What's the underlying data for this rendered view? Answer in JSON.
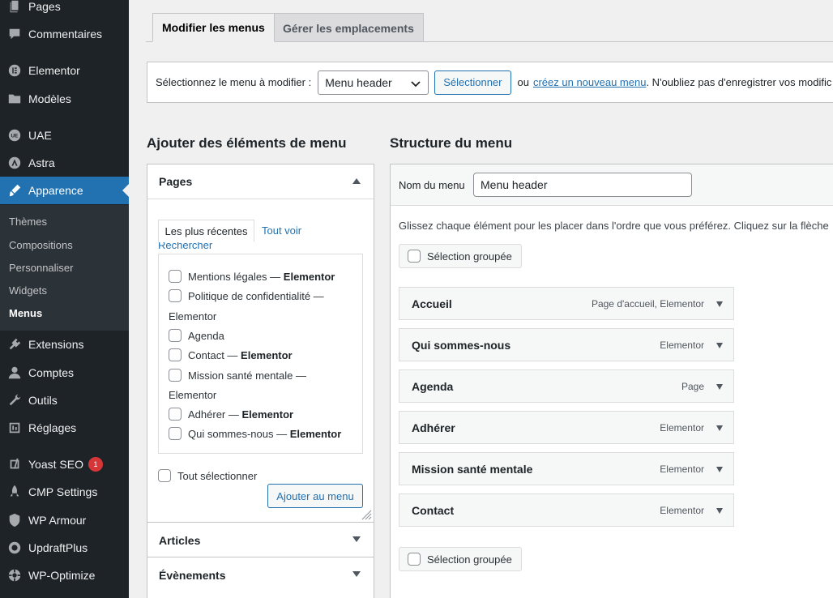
{
  "sidebar": {
    "items": [
      {
        "label": "Pages",
        "icon": "pages-icon"
      },
      {
        "label": "Commentaires",
        "icon": "comments-icon"
      },
      {
        "label": "Elementor",
        "icon": "elementor-icon"
      },
      {
        "label": "Modèles",
        "icon": "folder-icon"
      },
      {
        "label": "UAE",
        "icon": "uae-icon"
      },
      {
        "label": "Astra",
        "icon": "astra-icon"
      },
      {
        "label": "Apparence",
        "icon": "brush-icon"
      },
      {
        "label": "Extensions",
        "icon": "plugin-icon"
      },
      {
        "label": "Comptes",
        "icon": "user-icon"
      },
      {
        "label": "Outils",
        "icon": "wrench-icon"
      },
      {
        "label": "Réglages",
        "icon": "settings-icon"
      },
      {
        "label": "Yoast SEO",
        "icon": "yoast-icon",
        "badge": "1"
      },
      {
        "label": "CMP Settings",
        "icon": "rocket-icon"
      },
      {
        "label": "WP Armour",
        "icon": "shield-icon"
      },
      {
        "label": "UpdraftPlus",
        "icon": "updraft-icon"
      },
      {
        "label": "WP-Optimize",
        "icon": "optimize-icon"
      }
    ],
    "submenu": [
      "Thèmes",
      "Compositions",
      "Personnaliser",
      "Widgets",
      "Menus"
    ]
  },
  "tabs": {
    "edit": "Modifier les menus",
    "locations": "Gérer les emplacements"
  },
  "manage": {
    "label": "Sélectionnez le menu à modifier :",
    "selected": "Menu header",
    "select_button": "Sélectionner",
    "or": "ou",
    "create_link": "créez un nouveau menu",
    "tail": ". N'oubliez pas d'enregistrer vos modific"
  },
  "add_items": {
    "heading": "Ajouter des éléments de menu",
    "pages_title": "Pages",
    "tab_recent": "Les plus récentes",
    "tab_all": "Tout voir",
    "tab_search": "Rechercher",
    "pages": [
      {
        "name": "Mentions légales —",
        "tag": "Elementor"
      },
      {
        "name": "Politique de confidentialité —",
        "tag": "Elementor"
      },
      {
        "name": "Agenda",
        "tag": ""
      },
      {
        "name": "Contact —",
        "tag": "Elementor"
      },
      {
        "name": "Mission santé mentale —",
        "tag": "Elementor"
      },
      {
        "name": "Adhérer —",
        "tag": "Elementor"
      },
      {
        "name": "Qui sommes-nous —",
        "tag": "Elementor"
      }
    ],
    "select_all": "Tout sélectionner",
    "add_button": "Ajouter au menu",
    "articles": "Articles",
    "events": "Évènements"
  },
  "structure": {
    "heading": "Structure du menu",
    "name_label": "Nom du menu",
    "name_value": "Menu header",
    "instructions": "Glissez chaque élément pour les placer dans l'ordre que vous préférez. Cliquez sur la flèche",
    "bulk": "Sélection groupée",
    "items": [
      {
        "title": "Accueil",
        "type": "Page d'accueil, Elementor"
      },
      {
        "title": "Qui sommes-nous",
        "type": "Elementor"
      },
      {
        "title": "Agenda",
        "type": "Page"
      },
      {
        "title": "Adhérer",
        "type": "Elementor"
      },
      {
        "title": "Mission santé mentale",
        "type": "Elementor"
      },
      {
        "title": "Contact",
        "type": "Elementor"
      }
    ]
  }
}
